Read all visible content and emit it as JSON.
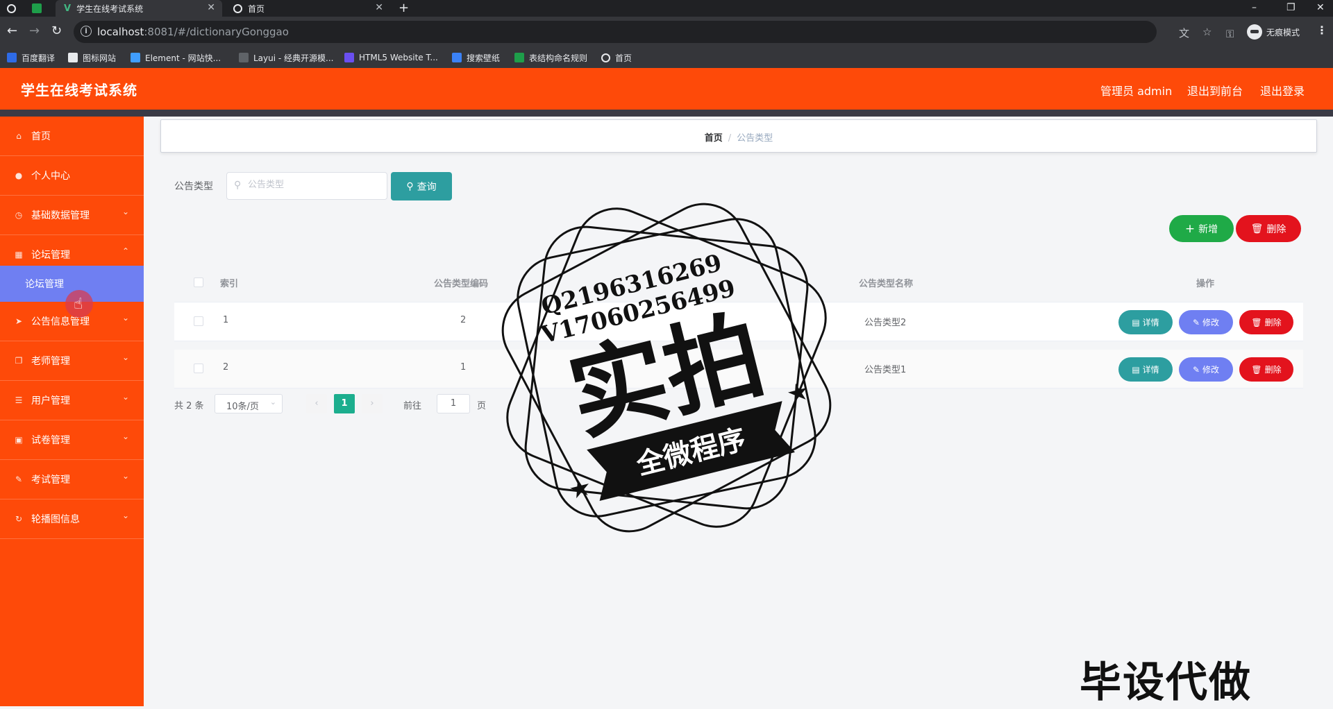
{
  "browser": {
    "tabs": [
      {
        "title": ""
      },
      {
        "title": "学生在线考试系统"
      },
      {
        "title": "首页"
      }
    ],
    "url_host": "localhost",
    "url_rest": ":8081/#/dictionaryGonggao",
    "incognito_label": "无痕模式",
    "bookmarks": [
      "百度翻译",
      "图标网站",
      "Element - 网站快...",
      "Layui - 经典开源模...",
      "HTML5 Website T...",
      "搜索壁纸",
      "表结构命名规则",
      "首页"
    ]
  },
  "app": {
    "title": "学生在线考试系统",
    "header_links": [
      "管理员 admin",
      "退出到前台",
      "退出登录"
    ]
  },
  "sidebar": {
    "items": [
      {
        "label": "首页",
        "icon": "home-icon"
      },
      {
        "label": "个人中心",
        "icon": "user-icon"
      },
      {
        "label": "基础数据管理",
        "icon": "clock-icon"
      },
      {
        "label": "论坛管理",
        "icon": "grid-icon"
      },
      {
        "label": "公告信息管理",
        "icon": "send-icon"
      },
      {
        "label": "老师管理",
        "icon": "copy-icon"
      },
      {
        "label": "用户管理",
        "icon": "list-icon"
      },
      {
        "label": "试卷管理",
        "icon": "picture-icon"
      },
      {
        "label": "考试管理",
        "icon": "pen-icon"
      },
      {
        "label": "轮播图信息",
        "icon": "refresh-icon"
      }
    ],
    "sub_item": "论坛管理"
  },
  "breadcrumb": {
    "home": "首页",
    "separator": "/",
    "current": "公告类型"
  },
  "filter": {
    "label": "公告类型",
    "placeholder": "公告类型",
    "query_button": "查询"
  },
  "actions": {
    "add": "新增",
    "delete": "删除"
  },
  "table": {
    "headers": [
      "索引",
      "公告类型编码",
      "公告类型名称",
      "操作"
    ],
    "rows": [
      {
        "index": "1",
        "code": "2",
        "name": "公告类型2"
      },
      {
        "index": "2",
        "code": "1",
        "name": "公告类型1"
      }
    ],
    "row_actions": {
      "detail": "详情",
      "edit": "修改",
      "delete": "删除"
    }
  },
  "pagination": {
    "total": "共 2 条",
    "page_size": "10条/页",
    "current_page": "1",
    "goto_label": "前往",
    "goto_value": "1",
    "page_unit": "页"
  },
  "watermark": {
    "line1": "Q2196316269",
    "line2": "V17060256499",
    "big": "实拍",
    "ribbon": "全微程序",
    "bottom": "毕设代做"
  },
  "colors": {
    "header": "#fe4a09",
    "sidebar": "#fe4a09",
    "submenu_active": "#6f7ff2",
    "teal": "#2d9ea0",
    "green": "#1faa47",
    "red": "#e3131d",
    "page_active": "#1cae8e"
  }
}
